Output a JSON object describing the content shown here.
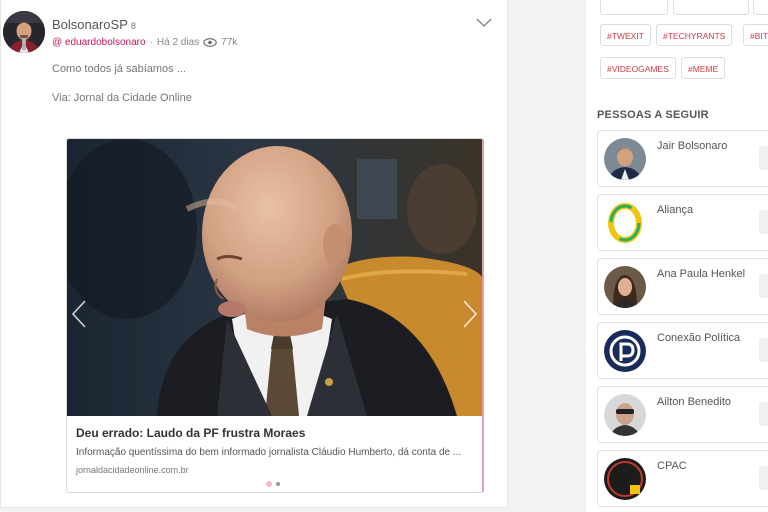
{
  "post": {
    "author": "BolsonaroSP",
    "badge": "8",
    "handle": "@ eduardobolsonaro",
    "time": "Há 2 dias",
    "views": "77k",
    "text": "Como todos já sabíamos ...",
    "via": "Via: Jornal da Cidade Online",
    "link": {
      "title": "Deu errado: Laudo da PF frustra Moraes",
      "description": "Informação quentíssima do bem informado jornalista Cláudio Humberto, dá conta de ...",
      "domain": "jornaldacidadeonline.com.br"
    }
  },
  "sidebar": {
    "tags": [
      "#TWEXIT",
      "#TECHYRANTS",
      "#BIT",
      "#VIDEOGAMES",
      "#MEME"
    ],
    "people_title": "PESSOAS A SEGUIR",
    "people": [
      {
        "name": "Jair Bolsonaro"
      },
      {
        "name": "Aliança"
      },
      {
        "name": "Ana Paula Henkel"
      },
      {
        "name": "Conexão Política"
      },
      {
        "name": "Ailton Benedito"
      },
      {
        "name": "CPAC"
      }
    ]
  },
  "colors": {
    "accent": "#d03a45",
    "handle": "#c2185b",
    "card_border": "#e2a0a8"
  }
}
